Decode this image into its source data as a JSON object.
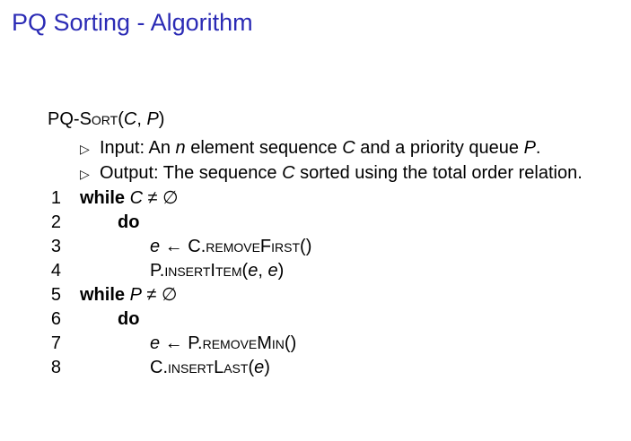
{
  "slide": {
    "title": "PQ Sorting - Algorithm",
    "title_color": "#2b2bb5"
  },
  "algorithm": {
    "name_prefix": "PQ-",
    "name_sc": "Sort",
    "param_open": "(",
    "param1": "C",
    "param_sep": ", ",
    "param2": "P",
    "param_close": ")",
    "comments": [
      {
        "marker": "▷",
        "parts": [
          "Input: An ",
          "n",
          " element sequence ",
          "C",
          " and a priority queue ",
          "P",
          "."
        ]
      },
      {
        "marker": "▷",
        "parts": [
          "Output: The sequence ",
          "C",
          " sorted using the total order relation."
        ]
      }
    ],
    "line_numbers": [
      "1",
      "2",
      "3",
      "4",
      "5",
      "6",
      "7",
      "8"
    ],
    "lines": {
      "l1": {
        "kw": "while",
        "var": "C",
        "op": " ≠ ∅"
      },
      "l2": {
        "kw": "do"
      },
      "l3": {
        "var": "e",
        "arrow": " ← ",
        "obj": "C.",
        "method": "removeFirst",
        "args": "()"
      },
      "l4": {
        "obj": "P.",
        "method": "insertItem",
        "open": "(",
        "a1": "e",
        "sep": ", ",
        "a2": "e",
        "close": ")"
      },
      "l5": {
        "kw": "while",
        "var": "P",
        "op": " ≠ ∅"
      },
      "l6": {
        "kw": "do"
      },
      "l7": {
        "var": "e",
        "arrow": " ← ",
        "obj": "P.",
        "method": "removeMin",
        "args": "()"
      },
      "l8": {
        "obj": "C.",
        "method": "insertLast",
        "open": "(",
        "a1": "e",
        "close": ")"
      }
    }
  }
}
